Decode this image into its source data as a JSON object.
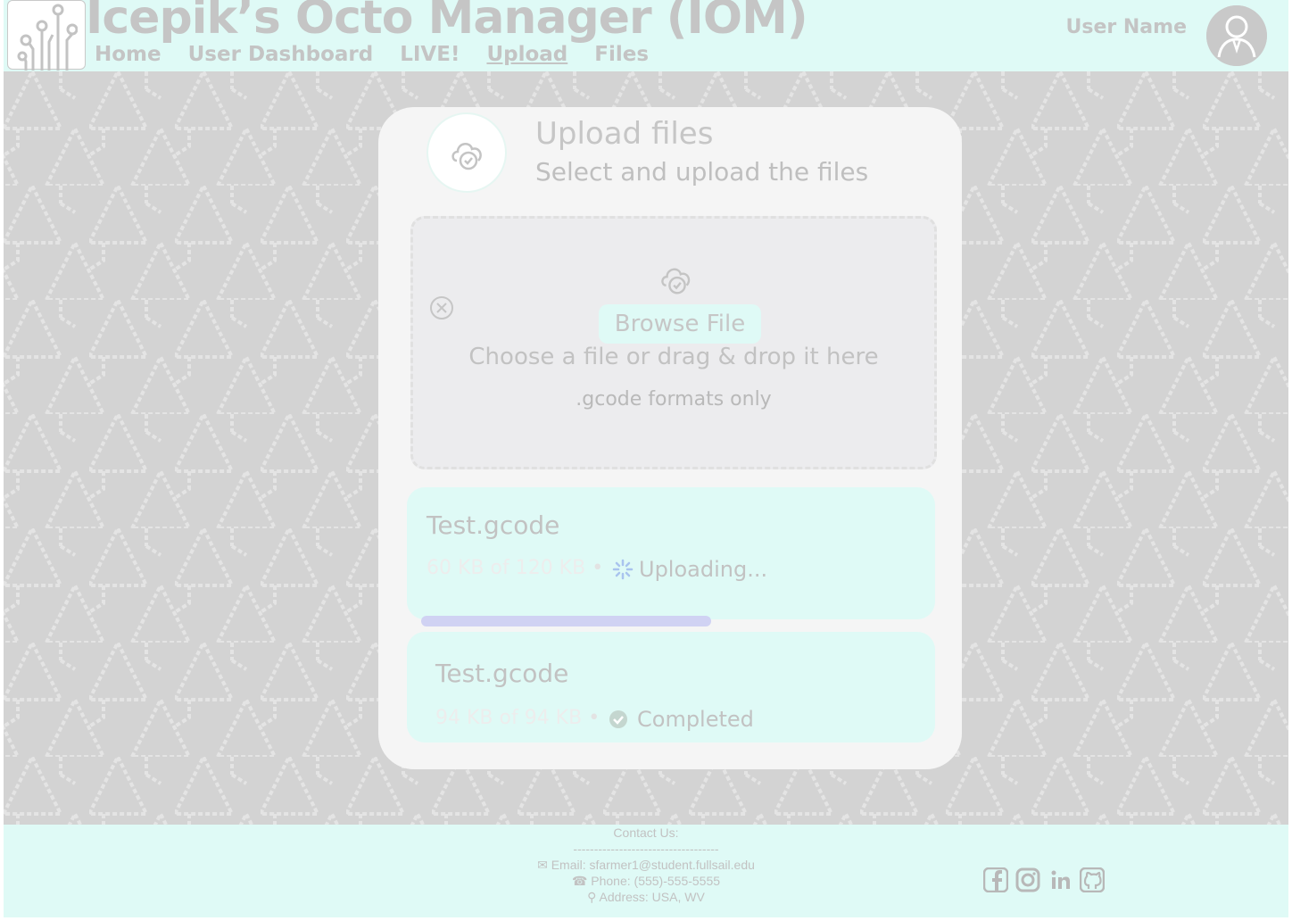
{
  "header": {
    "app_title": "Icepik’s Octo Manager (IOM)",
    "nav": [
      {
        "label": "Home",
        "active": false
      },
      {
        "label": "User Dashboard",
        "active": false
      },
      {
        "label": "LIVE!",
        "active": false
      },
      {
        "label": "Upload",
        "active": true
      },
      {
        "label": "Files",
        "active": false
      }
    ],
    "user_name": "User Name"
  },
  "upload_card": {
    "title": "Upload files",
    "subtitle": "Select and upload the files",
    "dropzone": {
      "browse_label": "Browse File",
      "instruction": "Choose a file or drag & drop it here",
      "formats_note": ".gcode formats only"
    },
    "files": [
      {
        "name": "Test.gcode",
        "size_text": "60 KB of 120 KB",
        "status": "Uploading...",
        "progress": 0.5
      },
      {
        "name": "Test.gcode",
        "size_text": "94 KB of 94 KB",
        "status": "Completed",
        "progress": 1.0
      }
    ]
  },
  "footer": {
    "contact_heading": "Contact Us:",
    "divider": "-----------------------------------",
    "email": "Email: sfarmer1@student.fullsail.edu",
    "phone": "Phone: (555)-555-5555",
    "address": "Address: USA, WV",
    "socials": [
      "facebook-icon",
      "instagram-icon",
      "linkedin-icon",
      "github-icon"
    ]
  },
  "colors": {
    "header_bg": "#dffaf6",
    "main_bg": "#d3d3d3",
    "card_bg": "#f5f5f5",
    "progress_fill": "#d0d2f3"
  }
}
